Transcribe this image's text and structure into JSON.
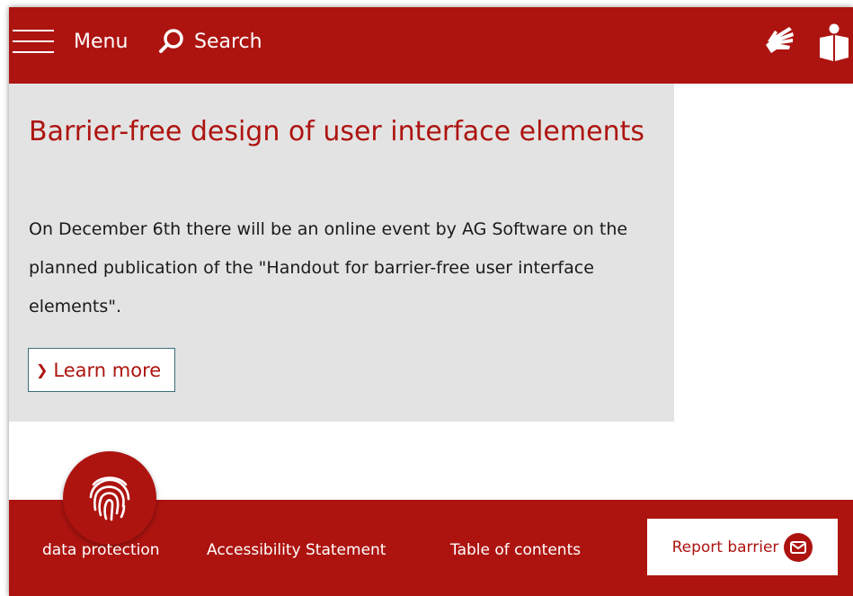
{
  "header": {
    "menu_label": "Menu",
    "search_label": "Search",
    "icons": [
      "hamburger-icon",
      "search-icon",
      "sign-language-icon",
      "easy-read-book-icon"
    ]
  },
  "teaser": {
    "title": "Barrier-free design of user interface elements",
    "text": "On December 6th there will be an online event by AG Software on the planned publication of the \"Handout for barrier-free user interface elements\".",
    "link_label": "Learn more"
  },
  "footer": {
    "links": [
      {
        "label": "data protection"
      },
      {
        "label": "Accessibility Statement"
      },
      {
        "label": "Table of contents"
      }
    ],
    "report_label": "Report barrier",
    "icons": [
      "fingerprint-icon",
      "mail-icon"
    ]
  },
  "colors": {
    "brand_red": "#ad1410",
    "card_gray": "#e3e3e3",
    "button_border": "#3a6f7a"
  }
}
